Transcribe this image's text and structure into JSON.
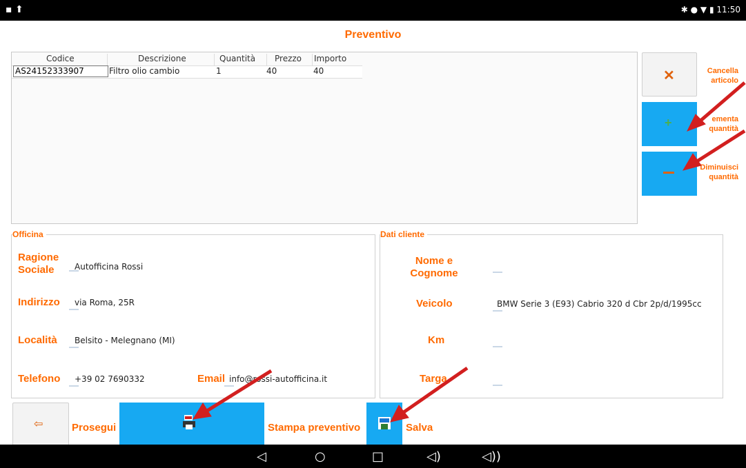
{
  "status": {
    "time": "11:50"
  },
  "page": {
    "title": "Preventivo"
  },
  "table": {
    "headers": [
      "Codice",
      "Descrizione",
      "Quantità",
      "Prezzo",
      "Importo"
    ],
    "rows": [
      [
        "AS24152333907",
        "Filtro olio cambio",
        "1",
        "40",
        "40"
      ]
    ]
  },
  "side": {
    "cancel_label_1": "Cancella",
    "cancel_label_2": "articolo",
    "increase_label_1": "ementa",
    "increase_label_2": "quantità",
    "decrease_label_1": "Diminuisci",
    "decrease_label_2": "quantità"
  },
  "officina": {
    "legend": "Officina",
    "ragione_label_1": "Ragione",
    "ragione_label_2": "Sociale",
    "ragione_value": "Autofficina Rossi",
    "indirizzo_label": "Indirizzo",
    "indirizzo_value": "via Roma, 25R",
    "localita_label": "Località",
    "localita_value": "Belsito - Melegnano (MI)",
    "telefono_label": "Telefono",
    "telefono_value": "+39 02 7690332",
    "email_label": "Email",
    "email_value": "info@rossi-autofficina.it"
  },
  "cliente": {
    "legend": "Dati cliente",
    "nome_label_1": "Nome e",
    "nome_label_2": "Cognome",
    "veicolo_label": "Veicolo",
    "veicolo_value": "BMW Serie 3 (E93) Cabrio 320 d Cbr 2p/d/1995cc",
    "km_label": "Km",
    "targa_label": "Targa"
  },
  "bottom": {
    "prosegui_label": "Prosegui",
    "stampa_label": "Stampa preventivo",
    "salva_label": "Salva"
  },
  "colors": {
    "accent": "#ff6a00",
    "blue": "#17a9f2",
    "arrow": "#d21f1f"
  }
}
